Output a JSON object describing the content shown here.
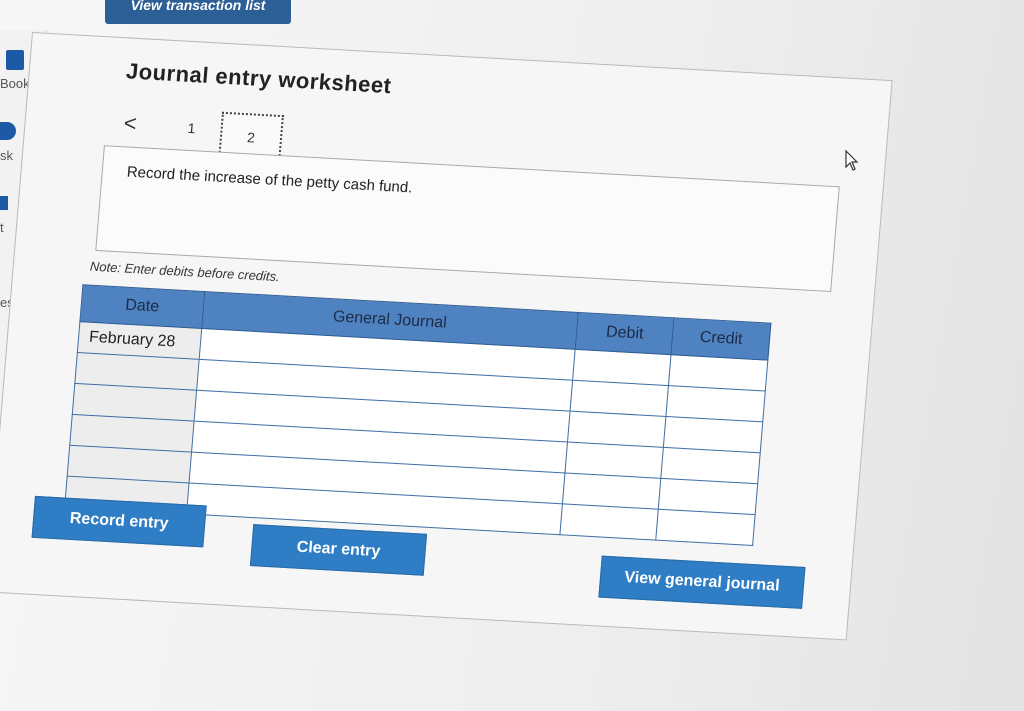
{
  "top_tab": {
    "label": "View transaction list"
  },
  "sidebar": {
    "items": [
      {
        "label": "Book"
      },
      {
        "label": "sk"
      },
      {
        "label": "t"
      },
      {
        "label": "es"
      }
    ]
  },
  "worksheet": {
    "title": "Journal entry worksheet",
    "pager": {
      "prev_symbol": "<",
      "pages": [
        "1",
        "2"
      ],
      "current": "2"
    },
    "instruction": "Record the increase of the petty cash fund.",
    "note": "Note: Enter debits before credits."
  },
  "table": {
    "headers": [
      "Date",
      "General Journal",
      "Debit",
      "Credit"
    ],
    "rows": [
      [
        "February 28",
        "",
        "",
        ""
      ],
      [
        "",
        "",
        "",
        ""
      ],
      [
        "",
        "",
        "",
        ""
      ],
      [
        "",
        "",
        "",
        ""
      ],
      [
        "",
        "",
        "",
        ""
      ],
      [
        "",
        "",
        "",
        ""
      ]
    ]
  },
  "buttons": {
    "record": "Record entry",
    "clear": "Clear entry",
    "view": "View general journal"
  },
  "colors": {
    "accent": "#2f7dc4",
    "header": "#4f82c0"
  }
}
